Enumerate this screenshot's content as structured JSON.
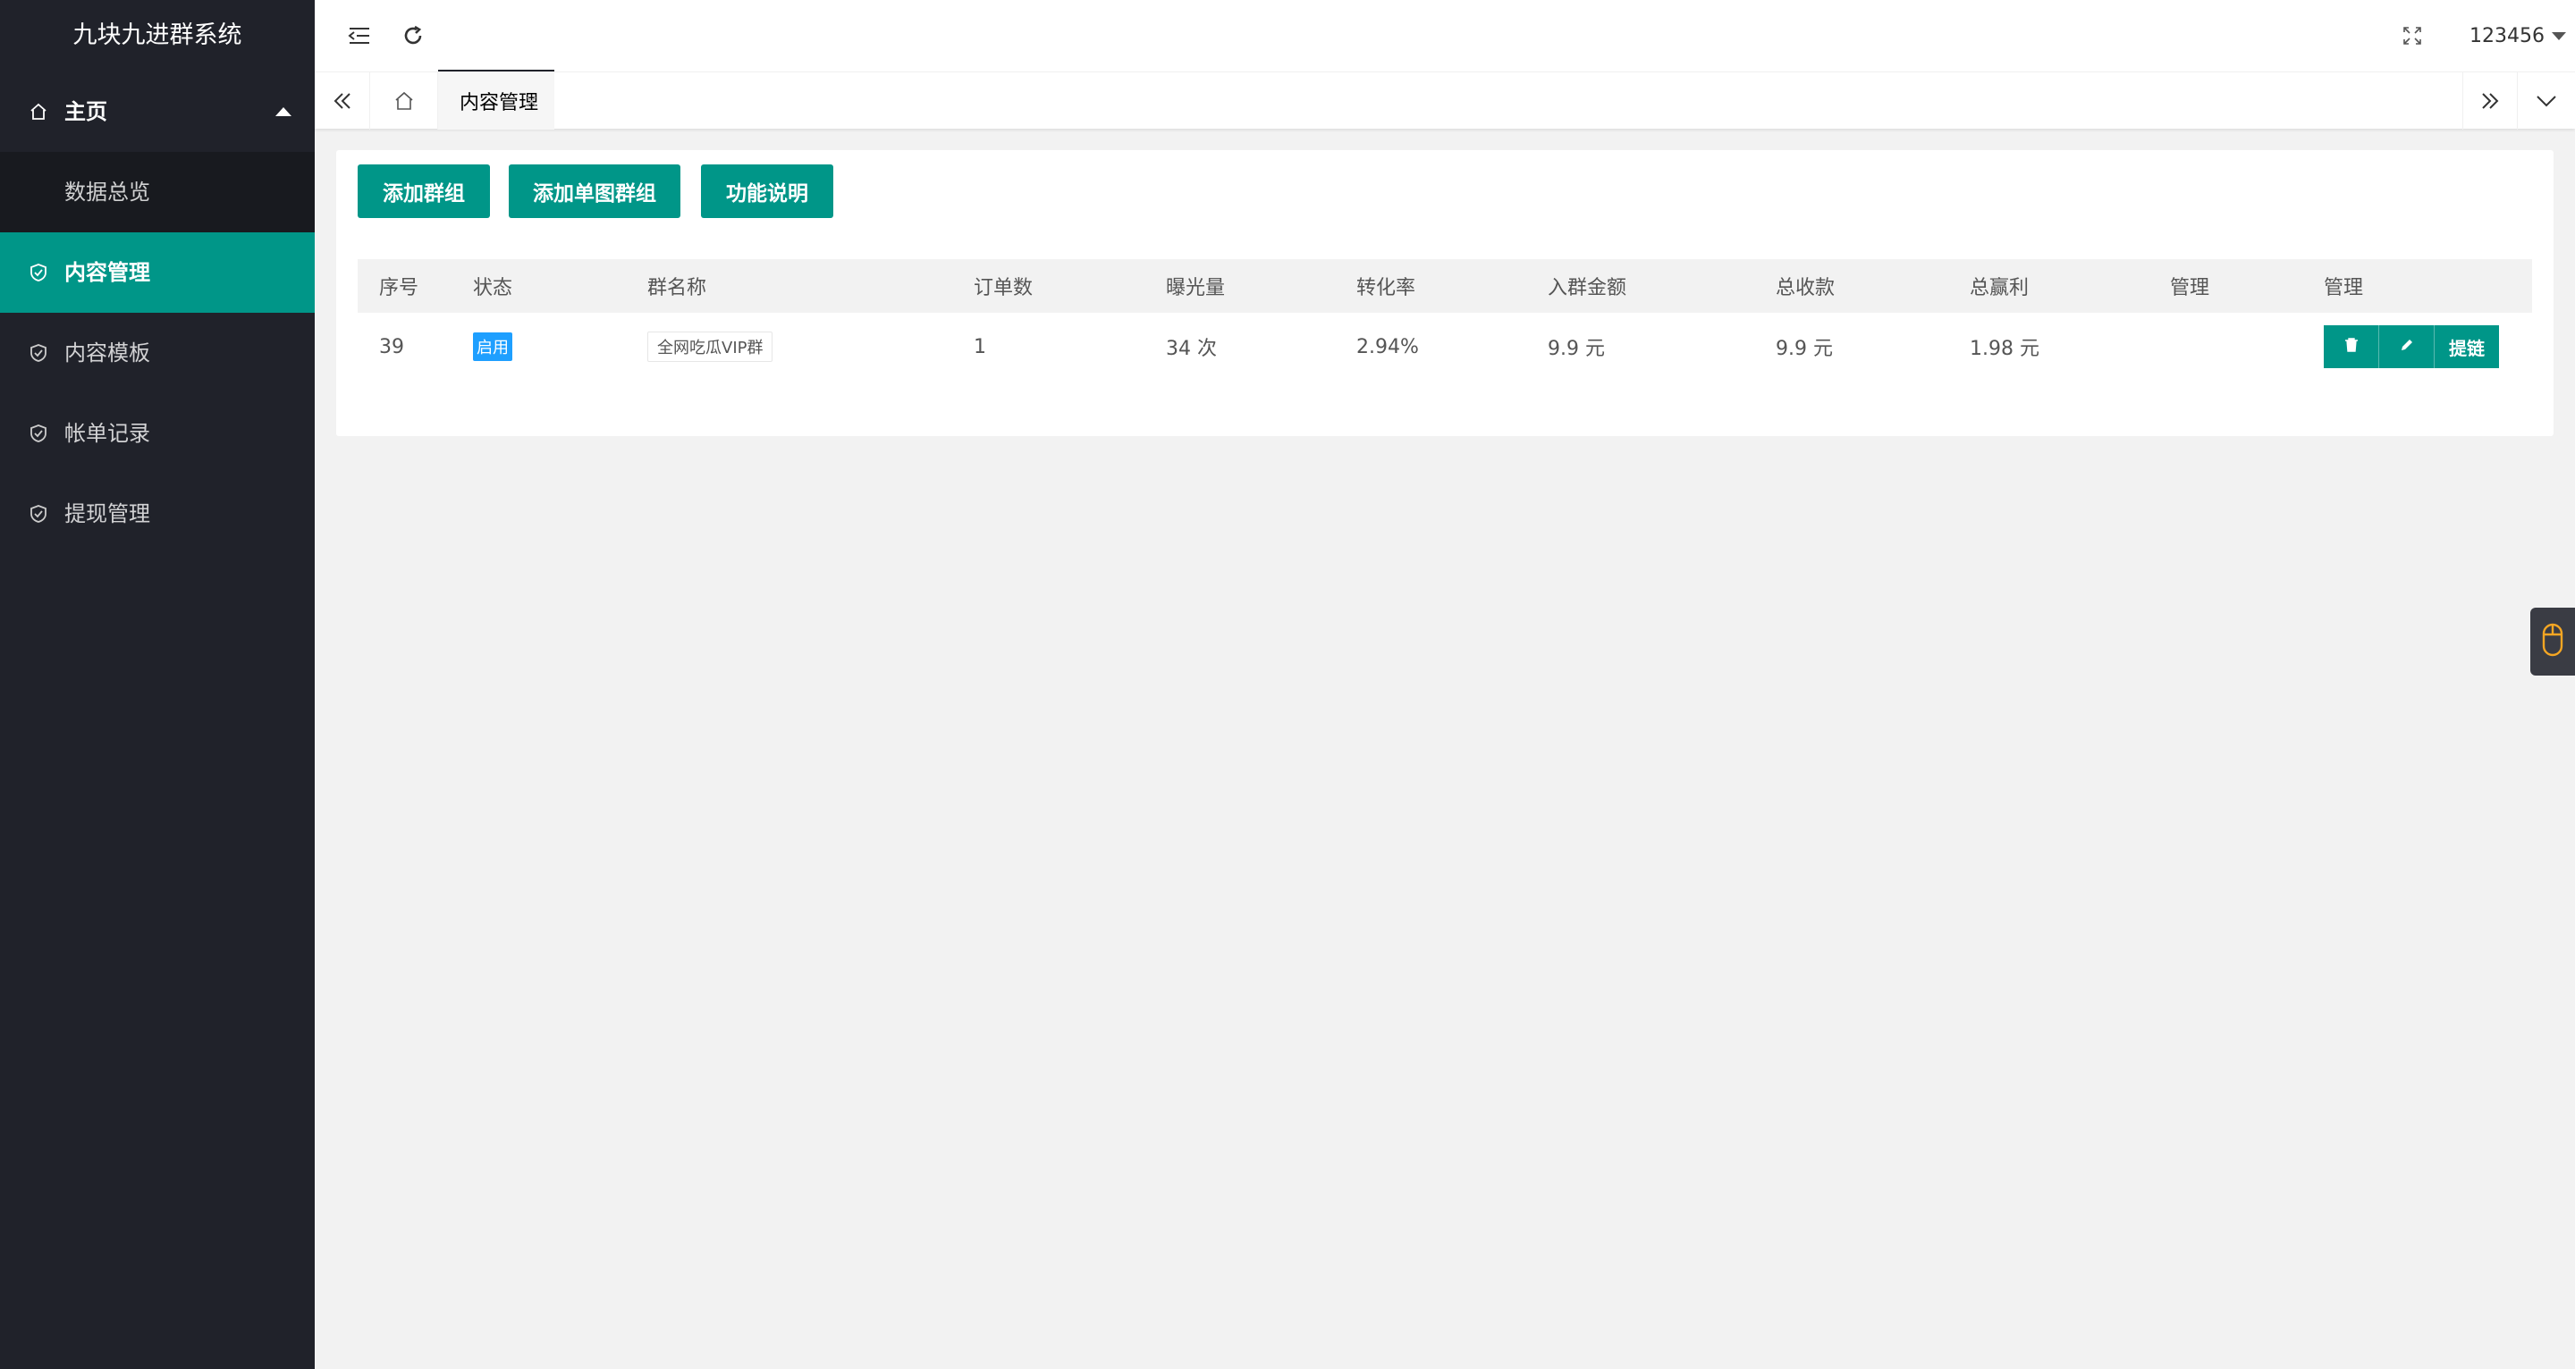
{
  "app": {
    "title": "九块九进群系统"
  },
  "sidebar": {
    "home_label": "主页",
    "sub_items": [
      {
        "label": "数据总览"
      }
    ],
    "items": [
      {
        "label": "内容管理",
        "icon": "shield-check-icon",
        "active": true
      },
      {
        "label": "内容模板",
        "icon": "shield-check-icon"
      },
      {
        "label": "帐单记录",
        "icon": "shield-check-icon"
      },
      {
        "label": "提现管理",
        "icon": "shield-check-icon"
      }
    ]
  },
  "header": {
    "username": "123456",
    "icons": [
      "menu-fold-icon",
      "refresh-icon",
      "fullscreen-icon"
    ]
  },
  "tabs": {
    "active_label": "内容管理",
    "close_glyph": "×"
  },
  "actions": {
    "add_group": "添加群组",
    "add_single_image_group": "添加单图群组",
    "help": "功能说明"
  },
  "table": {
    "headers": [
      "序号",
      "状态",
      "群名称",
      "订单数",
      "曝光量",
      "转化率",
      "入群金额",
      "总收款",
      "总赢利",
      "管理",
      "管理"
    ],
    "rows": [
      {
        "id": "39",
        "status": "启用",
        "name": "全网吃瓜VIP群",
        "orders": "1",
        "exposure": "34 次",
        "conversion": "2.94%",
        "entry_fee": "9.9 元",
        "total_received": "9.9 元",
        "total_profit": "1.98 元",
        "manage": "",
        "op_link_label": "提链"
      }
    ]
  },
  "colors": {
    "sidebar_bg": "#20222a",
    "accent": "#009688",
    "badge_blue": "#1e9fff"
  }
}
